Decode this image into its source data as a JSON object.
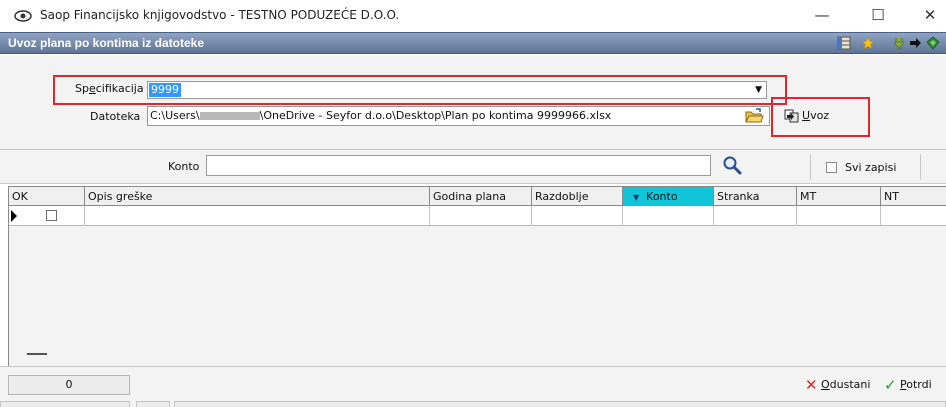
{
  "window": {
    "title": "Saop Financijsko knjigovodstvo - TESTNO PODUZEĆE D.O.O.",
    "minimize_glyph": "—",
    "maximize_glyph": "☐",
    "close_glyph": "✕"
  },
  "header": {
    "title": "Uvoz plana po kontima iz datoteke",
    "icons": [
      "layout-icon",
      "star-icon",
      "plugin-icon",
      "arrow-right-icon",
      "book-icon"
    ]
  },
  "form": {
    "specifikacija_label_pre": "Sp",
    "specifikacija_label_ul": "e",
    "specifikacija_label_post": "cifikacija",
    "specifikacija_value": "9999",
    "datoteka_label": "Datoteka",
    "file_path_prefix": "C:\\Users\\",
    "file_path_suffix": "\\OneDrive - Seyfor d.o.o\\Desktop\\Plan po kontima 9999966.xlsx",
    "uvoz_label_ul": "U",
    "uvoz_label_post": "voz"
  },
  "search": {
    "konto_label": "Konto",
    "konto_value": "",
    "svi_zapisi_label": "Svi zapisi"
  },
  "grid": {
    "columns": [
      "OK",
      "Opis greške",
      "Godina plana",
      "Razdoblje",
      "Konto",
      "Stranka",
      "MT",
      "NT"
    ],
    "sort_glyph": "▼"
  },
  "footer": {
    "count": "0",
    "odustani_ul": "O",
    "odustani_post": "dustani",
    "potrdi_ul": "P",
    "potrdi_post": "otrdi"
  },
  "colors": {
    "header_bar": "#6d82a6",
    "active_column": "#10c5d8",
    "highlight_red": "#e0262f",
    "selection_blue": "#3399ff"
  }
}
